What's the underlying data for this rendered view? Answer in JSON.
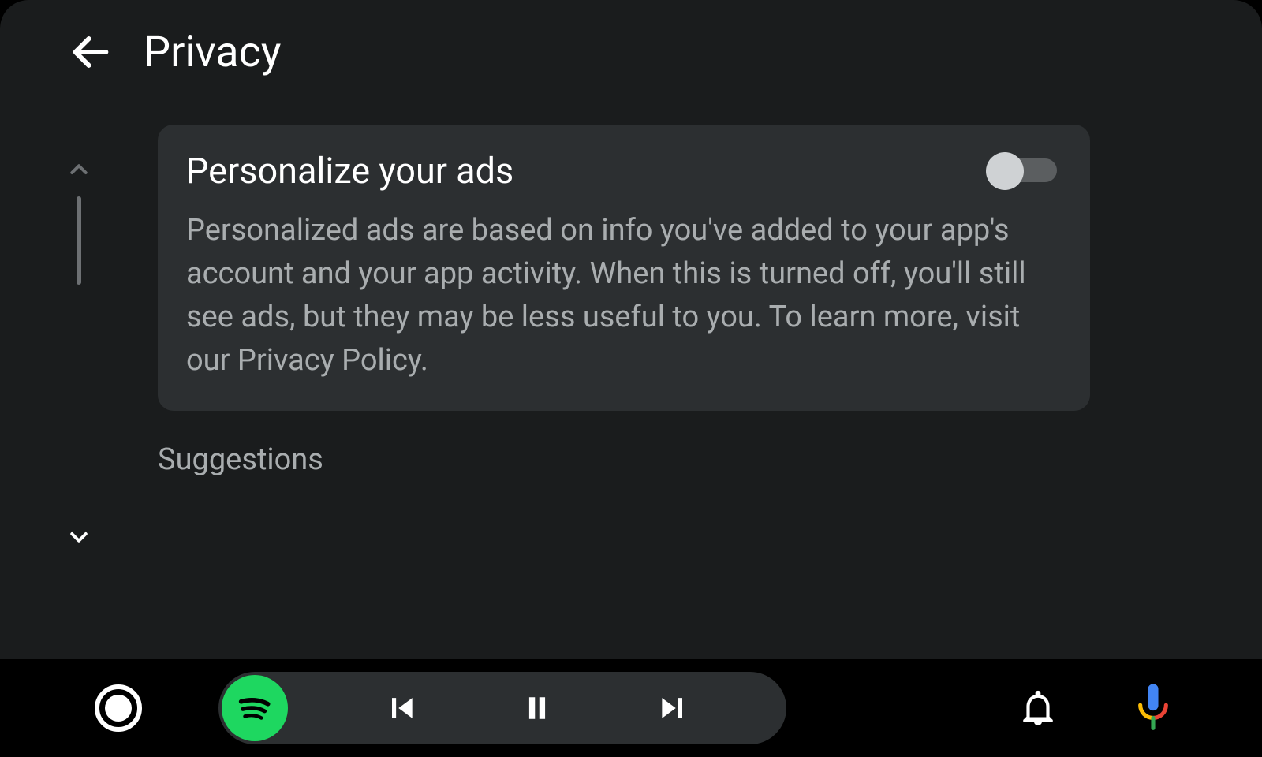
{
  "header": {
    "title": "Privacy"
  },
  "card": {
    "title": "Personalize your ads",
    "body": "Personalized ads are based on info you've added to your app's account and your app activity. When this is turned off, you'll still see ads, but they may be less useful to you. To learn more, visit our Privacy Policy.",
    "toggle_on": false
  },
  "section_label": "Suggestions",
  "icons": {
    "back": "arrow-left",
    "scroll_up": "chevron-up",
    "scroll_down": "chevron-down",
    "home": "home-circle",
    "spotify": "spotify",
    "prev": "skip-previous",
    "pause": "pause",
    "next": "skip-next",
    "bell": "notifications",
    "mic": "google-mic"
  },
  "colors": {
    "app_bg": "#1a1c1d",
    "card_bg": "#2c2f31",
    "text_primary": "#ffffff",
    "text_secondary": "#a9adaf",
    "spotify_green": "#1ed760"
  }
}
